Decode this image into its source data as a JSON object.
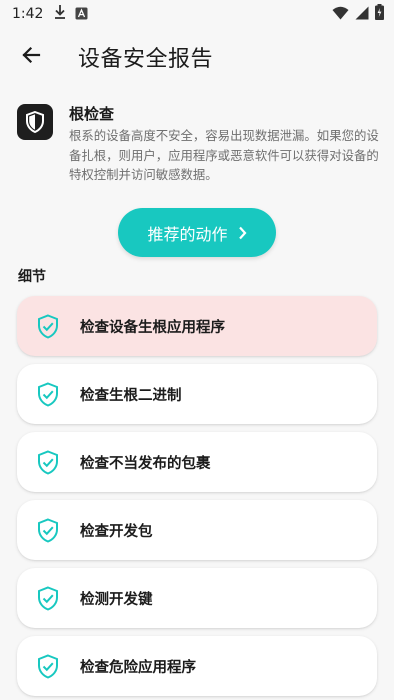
{
  "status_bar": {
    "time": "1:42",
    "left_icons": [
      "download-icon",
      "app-a-icon"
    ],
    "right_icons": [
      "wifi-icon",
      "signal-icon",
      "battery-icon"
    ]
  },
  "app_bar": {
    "title": "设备安全报告",
    "back_icon": "back-arrow-icon"
  },
  "intro": {
    "icon": "shield-icon",
    "title": "根检查",
    "description": "根系的设备高度不安全，容易出现数据泄漏。如果您的设备扎根，则用户，应用程序或恶意软件可以获得对设备的特权控制并访问敏感数据。"
  },
  "action_button": {
    "label": "推荐的动作",
    "icon": "chevron-right-icon"
  },
  "details": {
    "header": "细节",
    "items": [
      {
        "label": "检查设备生根应用程序",
        "icon": "shield-check-icon",
        "state": "alert"
      },
      {
        "label": "检查生根二进制",
        "icon": "shield-check-icon",
        "state": "ok"
      },
      {
        "label": "检查不当发布的包裹",
        "icon": "shield-check-icon",
        "state": "ok"
      },
      {
        "label": "检查开发包",
        "icon": "shield-check-icon",
        "state": "ok"
      },
      {
        "label": "检测开发键",
        "icon": "shield-check-icon",
        "state": "ok"
      },
      {
        "label": "检查危险应用程序",
        "icon": "shield-check-icon",
        "state": "ok"
      }
    ]
  },
  "colors": {
    "accent": "#18c8c0",
    "alert_card": "#fbe3e3",
    "card": "#ffffff",
    "background": "#f7f7f7"
  }
}
